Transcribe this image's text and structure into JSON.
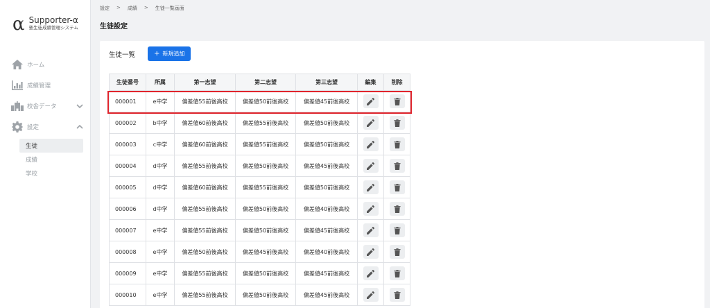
{
  "brand": {
    "alpha": "α",
    "name": "Supporter-α",
    "subtitle": "塾生徒成績管理システム"
  },
  "sidebar": {
    "items": [
      {
        "label": "ホーム",
        "icon": "home-icon"
      },
      {
        "label": "成績管理",
        "icon": "chart-icon"
      },
      {
        "label": "校舎データ",
        "icon": "building-icon",
        "chevron": "down"
      },
      {
        "label": "設定",
        "icon": "gear-icon",
        "chevron": "up"
      }
    ],
    "sub_items": [
      {
        "label": "生徒",
        "active": true
      },
      {
        "label": "成績",
        "active": false
      },
      {
        "label": "学校",
        "active": false
      }
    ]
  },
  "breadcrumb": {
    "items": [
      "設定",
      "成績",
      "生徒一覧画面"
    ],
    "separator": ">"
  },
  "page_title": "生徒設定",
  "list": {
    "title": "生徒一覧",
    "add_button": {
      "plus": "+",
      "label": "新規追加"
    },
    "columns": [
      "生徒番号",
      "所属",
      "第一志望",
      "第二志望",
      "第三志望",
      "編集",
      "削除"
    ],
    "rows": [
      [
        "000001",
        "e中学",
        "偏差値55前後高校",
        "偏差値50前後高校",
        "偏差値45前後高校"
      ],
      [
        "000002",
        "b中学",
        "偏差値60前後高校",
        "偏差値55前後高校",
        "偏差値50前後高校"
      ],
      [
        "000003",
        "c中学",
        "偏差値60前後高校",
        "偏差値55前後高校",
        "偏差値50前後高校"
      ],
      [
        "000004",
        "d中学",
        "偏差値55前後高校",
        "偏差値50前後高校",
        "偏差値45前後高校"
      ],
      [
        "000005",
        "d中学",
        "偏差値60前後高校",
        "偏差値55前後高校",
        "偏差値50前後高校"
      ],
      [
        "000006",
        "d中学",
        "偏差値55前後高校",
        "偏差値50前後高校",
        "偏差値40前後高校"
      ],
      [
        "000007",
        "e中学",
        "偏差値55前後高校",
        "偏差値50前後高校",
        "偏差値45前後高校"
      ],
      [
        "000008",
        "e中学",
        "偏差値50前後高校",
        "偏差値45前後高校",
        "偏差値40前後高校"
      ],
      [
        "000009",
        "e中学",
        "偏差値55前後高校",
        "偏差値50前後高校",
        "偏差値45前後高校"
      ],
      [
        "000010",
        "e中学",
        "偏差値55前後高校",
        "偏差値50前後高校",
        "偏差値45前後高校"
      ]
    ],
    "highlighted_row": 0
  },
  "colors": {
    "accent": "#1a73e8",
    "highlight": "#e0242c",
    "background": "#f1f2f4"
  }
}
